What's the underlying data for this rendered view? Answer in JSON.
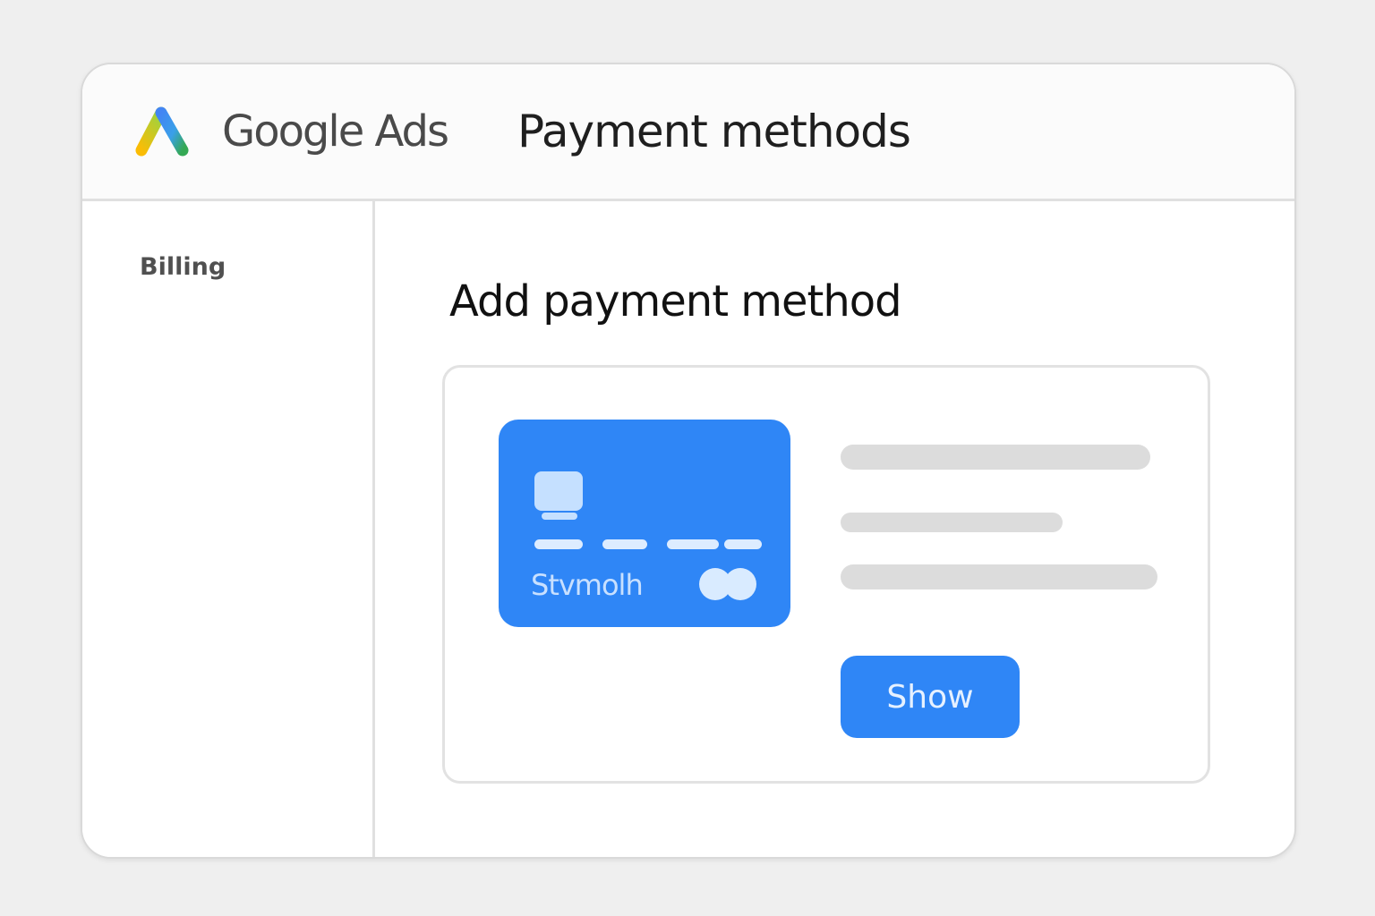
{
  "header": {
    "brand": "Google Ads",
    "title": "Payment methods",
    "logo_icon": "google-ads-logo-icon"
  },
  "sidebar": {
    "items": [
      {
        "label": "Billing"
      }
    ]
  },
  "main": {
    "section_title": "Add payment method",
    "card": {
      "name": "Stvmolh",
      "brand_icon": "mastercard-icon",
      "chip_icon": "card-chip-icon"
    },
    "show_button_label": "Show"
  },
  "colors": {
    "accent": "#2f86f6",
    "card_light": "#c5e0ff",
    "skeleton": "#dcdcdc",
    "logo_yellow": "#fbbc04",
    "logo_blue": "#4285f4",
    "logo_green": "#34a853"
  }
}
